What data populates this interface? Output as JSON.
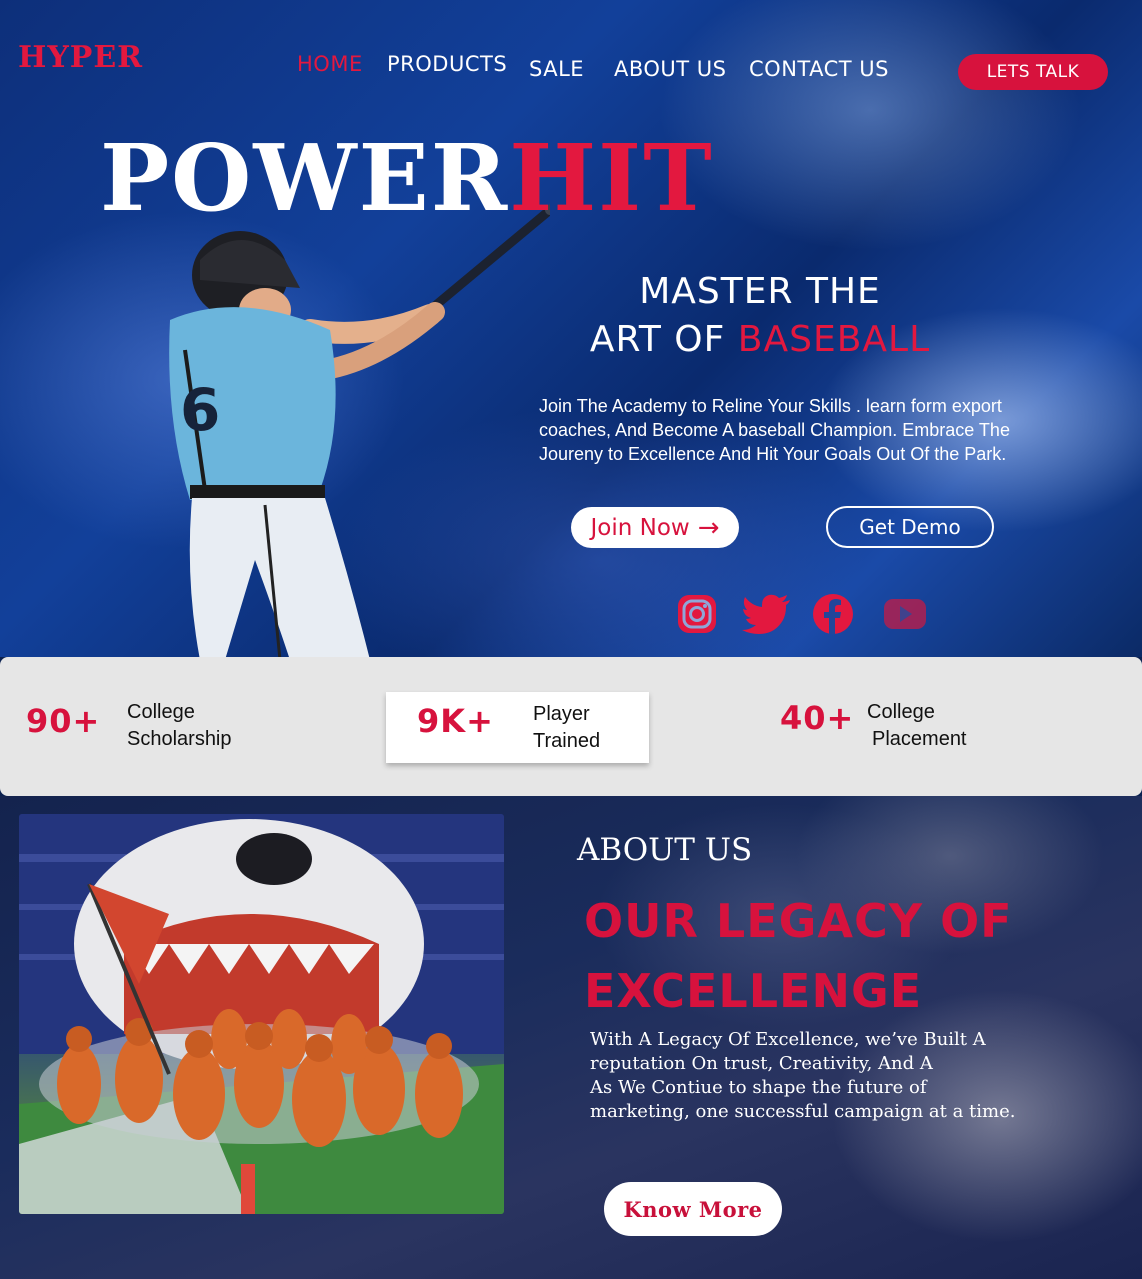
{
  "brand": {
    "logo": "HYPER"
  },
  "nav": {
    "items": [
      {
        "label": "HOME",
        "active": true
      },
      {
        "label": "PRODUCTS",
        "active": false
      },
      {
        "label": "SALE",
        "active": false
      },
      {
        "label": "ABOUT US",
        "active": false
      },
      {
        "label": "CONTACT US",
        "active": false
      }
    ],
    "cta": "LETS TALK"
  },
  "hero": {
    "title_white": "POWER",
    "title_red": "HIT",
    "tagline_line1": "MASTER THE",
    "tagline_line2_white": "ART OF",
    "tagline_line2_red": "BASEBALL",
    "intro": "Join The Academy to Reline Your Skills . learn form export coaches, And Become A baseball Champion. Embrace The Joureny to Excellence And Hit Your Goals Out Of the Park.",
    "join_label": "Join Now",
    "join_arrow": "→",
    "demo_label": "Get Demo",
    "social_icons": [
      "instagram-icon",
      "twitter-icon",
      "facebook-icon",
      "youtube-icon"
    ]
  },
  "stats": [
    {
      "number": "90+",
      "label_line1": "College",
      "label_line2": "Scholarship"
    },
    {
      "number": "9K+",
      "label_line1": "Player",
      "label_line2": "Trained"
    },
    {
      "number": "40+",
      "label_line1": "College",
      "label_line2": "Placement"
    }
  ],
  "about": {
    "label": "ABOUT US",
    "heading_line1": "OUR LEGACY OF",
    "heading_line2": "EXCELLENGE",
    "text": "With A Legacy Of Excellence, we’ve Built A\nreputation On trust, Creativity, And A\nAs We Contiue to shape the future of\n marketing, one successful campaign at a time.",
    "button": "Know More"
  },
  "colors": {
    "accent": "#d7123d",
    "hero_bg": "#12409a",
    "stats_bg": "#e6e6e6"
  }
}
